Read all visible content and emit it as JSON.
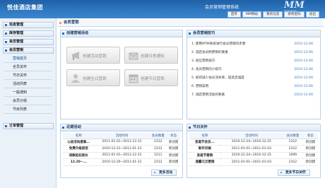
{
  "header": {
    "brand": "悦佳酒店集团",
    "system_title": "会员营销管理系统",
    "logo_text": "MM",
    "logo_sub": "营销管理系统",
    "nav": [
      "首页",
      "MM网站",
      "我的信息",
      "修改密码",
      "退出"
    ]
  },
  "sidebar": {
    "groups": [
      "信息管理",
      "库存管理",
      "会员管理",
      "会员营销",
      "订单管理"
    ],
    "sub_items": [
      "营销首页",
      "全员关怀",
      "节日关怀",
      "活动列表",
      "一般通知",
      "会员分组",
      "节目列表"
    ]
  },
  "main": {
    "breadcrumb": "会员营销",
    "create_panel": {
      "title": "创建营销活动",
      "buttons": [
        "创建活动营销",
        "创建日常通知",
        "创建生日营销",
        "创建节日营销"
      ]
    },
    "tips_panel": {
      "title": "会员营销技巧",
      "items": [
        {
          "text": "1. 使用MTM系统进行会员营销的步骤",
          "date": "2010-12-06"
        },
        {
          "text": "2. 酒店会员制营销的要素",
          "date": "2010-12-06"
        },
        {
          "text": "3. 短信营销技巧",
          "date": "2010-12-06"
        },
        {
          "text": "4. 会员营销的小技巧",
          "date": "2010-12-06"
        },
        {
          "text": "5. 如何减少会员流失率，提高忠诚度",
          "date": "2010-12-06"
        },
        {
          "text": "6. 营销案例",
          "date": "2010-12-06"
        },
        {
          "text": "7. 酒店营销活动的要素",
          "date": "2010-12-06"
        }
      ]
    },
    "recent_panel": {
      "title": "近期活动",
      "columns": [
        "名称",
        "活动时间",
        "会员数量",
        "状态"
      ],
      "rows": [
        [
          "公益活动提高...",
          "2011-01-01~2011-12-31",
          "2312",
          "新创建"
        ],
        [
          "免费升级房型",
          "2010-12-21~2011-01-21",
          "2312",
          "新创建"
        ],
        [
          "退款抵扣房价",
          "2011-01-01~2011-12-31",
          "1211",
          "新创建"
        ],
        [
          "12.20~...",
          "2010-12-20~2011-01-31",
          "2312",
          "新创建"
        ]
      ],
      "more": "更多活动"
    },
    "holiday_panel": {
      "title": "节日关怀",
      "columns": [
        "名称",
        "活动时间",
        "会员数量",
        "状态"
      ],
      "rows": [
        [
          "圣诞节会员...",
          "2010-12-24~2010-12-25",
          "2312",
          "新创建"
        ],
        [
          "新年问候",
          "2011-01-01~2011-01-03",
          "2312",
          "新创建"
        ],
        [
          "圣诞节营销",
          "2010-12-24~2010-12-25",
          "1099",
          "新创建"
        ],
        [
          "温馨元旦营销",
          "2011-01-01~2011-01-03",
          "2312",
          "新创建"
        ]
      ],
      "more": "更多节日关怀"
    }
  },
  "colors": {
    "header_blue": "#2e78c0",
    "link_blue": "#3a79be",
    "sidebar_bg": "#eaf1f8"
  }
}
